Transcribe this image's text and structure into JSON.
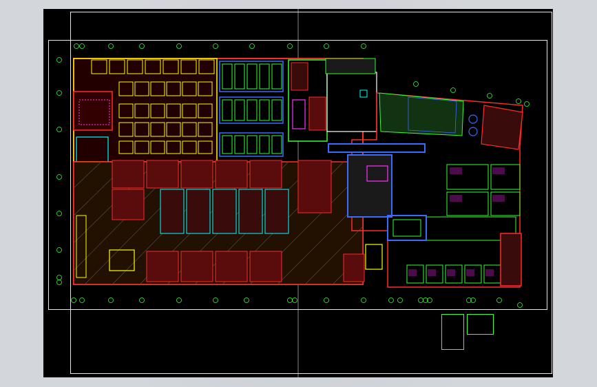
{
  "viewer": {
    "background_color": "#000000",
    "frame_color": "#e6e6e6",
    "colors": {
      "walls": "#ff2a2a",
      "partitions": "#ffff00",
      "cyan": "#00ffff",
      "green": "#33ff33",
      "magenta": "#ff33ff",
      "blue": "#3b6bff",
      "white": "#ffffff"
    }
  },
  "icons": [
    "grid-axis-bubble-icon"
  ]
}
